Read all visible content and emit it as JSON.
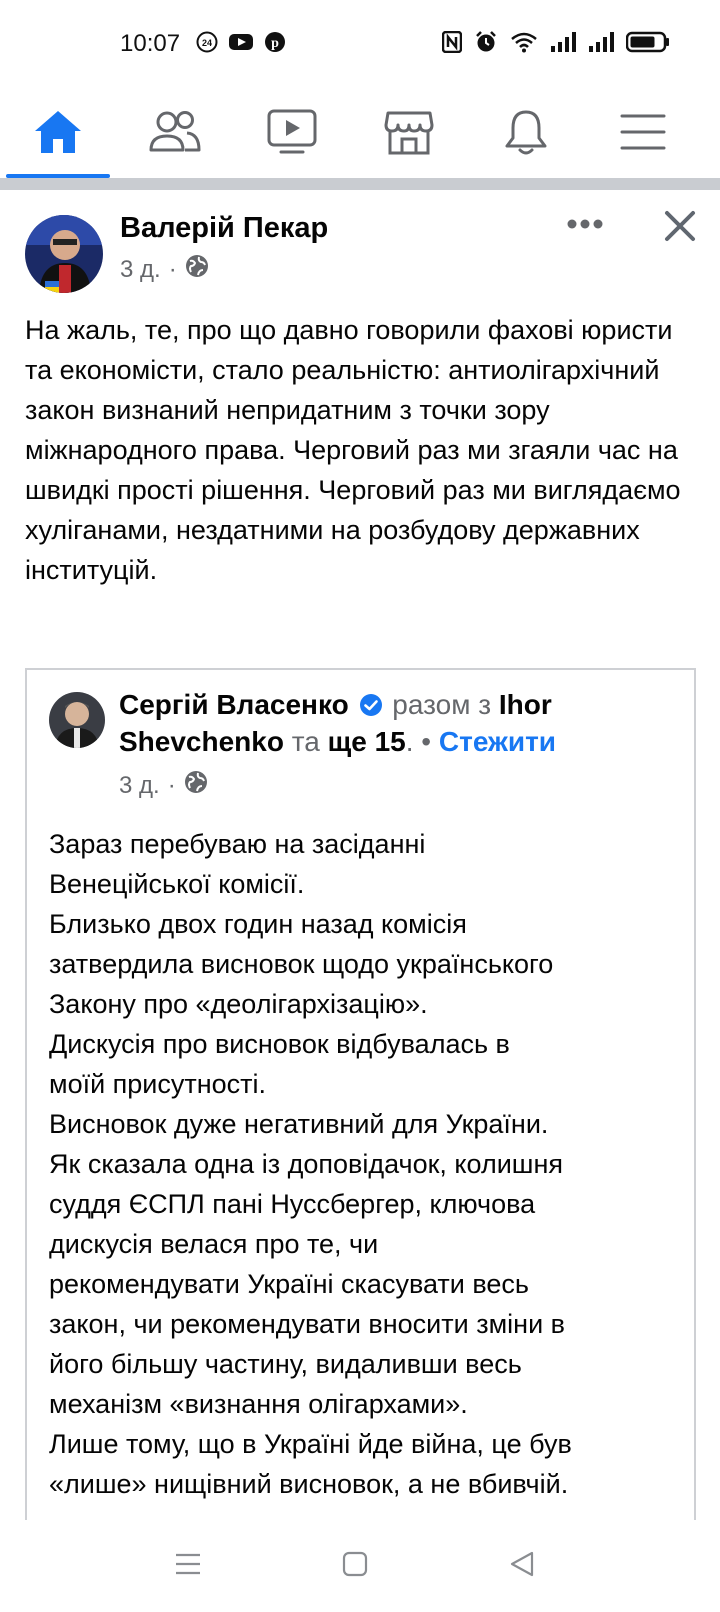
{
  "status_bar": {
    "time": "10:07",
    "left_icons": [
      "24-news-icon",
      "youtube-icon",
      "pinterest-icon"
    ],
    "right_icons": [
      "nfc-icon",
      "alarm-icon",
      "wifi-icon",
      "signal-icon",
      "signal-icon",
      "battery-icon"
    ]
  },
  "nav": {
    "items": [
      {
        "name": "home",
        "icon": "home-icon",
        "active": true
      },
      {
        "name": "friends",
        "icon": "friends-icon",
        "active": false
      },
      {
        "name": "watch",
        "icon": "video-icon",
        "active": false
      },
      {
        "name": "marketplace",
        "icon": "marketplace-icon",
        "active": false
      },
      {
        "name": "notifications",
        "icon": "bell-icon",
        "active": false
      },
      {
        "name": "menu",
        "icon": "menu-icon",
        "active": false
      }
    ],
    "accent": "#1877f2"
  },
  "post": {
    "author": "Валерій Пекар",
    "time": "3 д.",
    "privacy_sep": "·",
    "text": "На жаль, те, про що давно говорили фахові юристи та економісти, стало реальністю: антиолігархічний закон визнаний непридатним з точки зору міжнародного права. Черговий раз ми згаяли час на швидкі прості рішення. Черговий раз ми виглядаємо хуліганами, нездатними на розбудову державних інституцій.",
    "shared": {
      "author": "Сергій Власенко",
      "with_label": "разом з",
      "with_name": "Ihor Shevchenko",
      "and_label": "та",
      "others": "ще 15",
      "dot": ". •",
      "follow_label": "Стежити",
      "time": "3 д.",
      "privacy_sep": "·",
      "lines": [
        "Зараз перебуваю на засіданні",
        "Венеційської комісії.",
        "Близько двох годин назад комісія",
        "затвердила висновок щодо українського",
        "Закону про «деолігархізацію».",
        "Дискусія про висновок відбувалась в",
        "моїй присутності.",
        "Висновок дуже негативний для України.",
        "Як сказала одна із доповідачок, колишня",
        "суддя ЄСПЛ пані Нуссбергер, ключова",
        "дискусія велася про те, чи",
        "рекомендувати Україні скасувати весь",
        "закон, чи рекомендувати вносити зміни в",
        "його більшу частину, видаливши весь",
        "механізм «визнання олігархами».",
        "Лише тому, що в Україні йде війна, це був",
        "«лише» нищівний висновок, а не вбивчій."
      ]
    }
  }
}
